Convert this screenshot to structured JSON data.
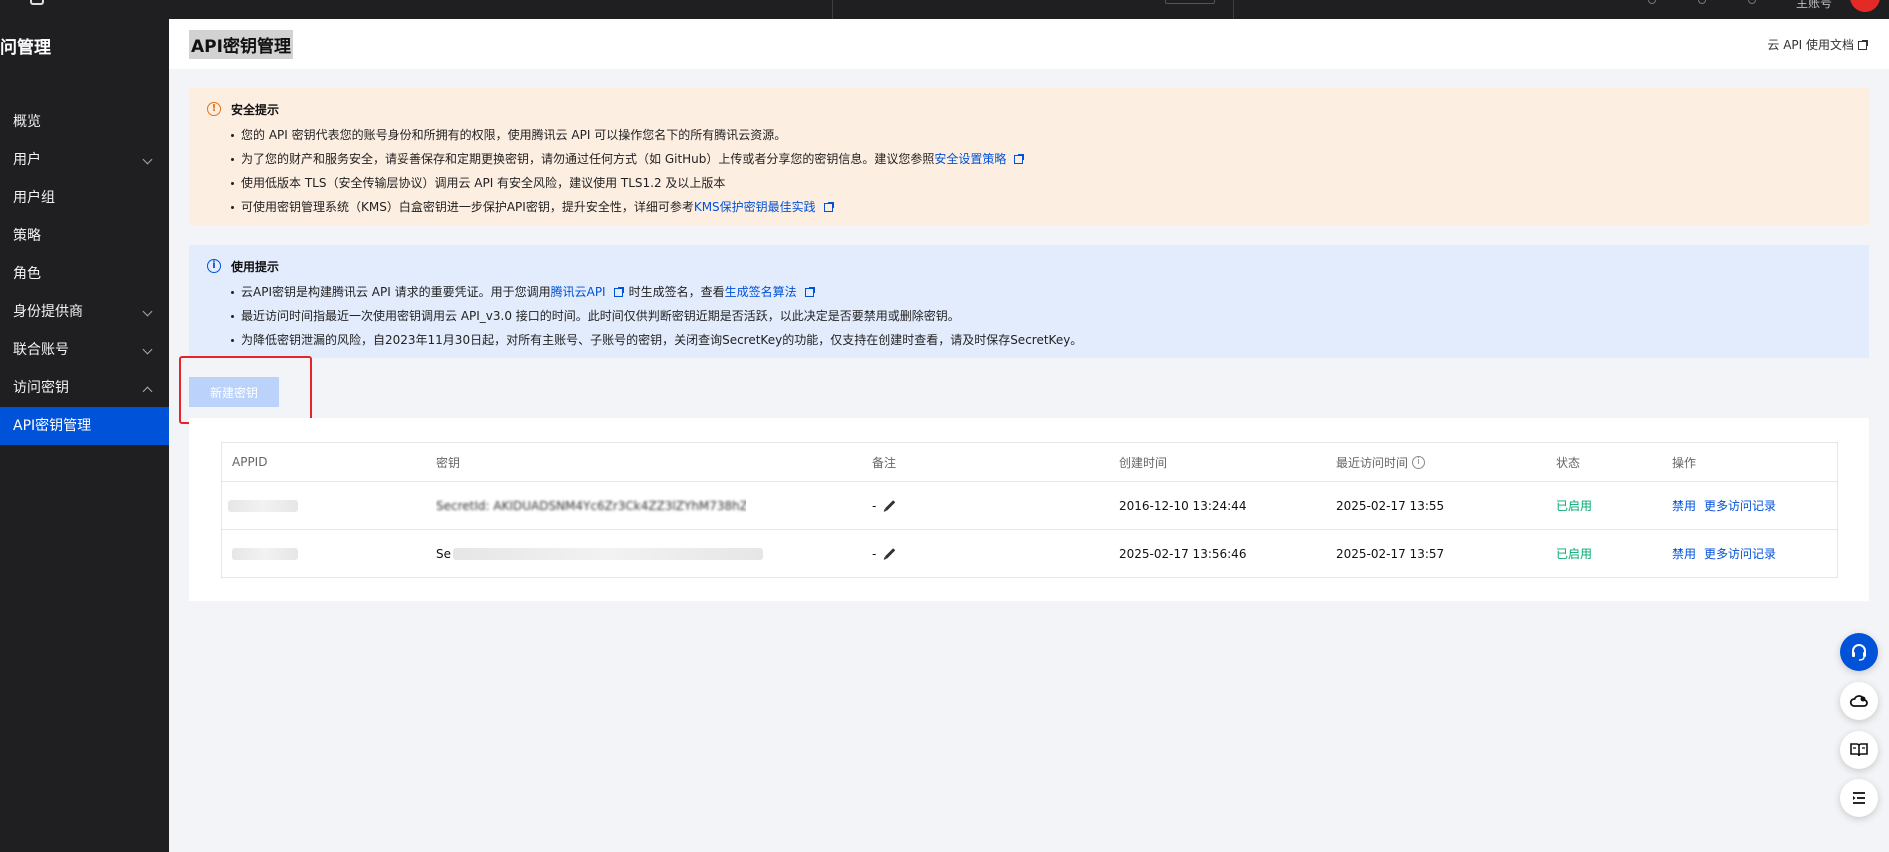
{
  "topbar": {
    "account": "主账号"
  },
  "sidebar": {
    "title": "问管理",
    "items": [
      {
        "label": "概览",
        "chevron": null
      },
      {
        "label": "用户",
        "chevron": "down"
      },
      {
        "label": "用户组",
        "chevron": null
      },
      {
        "label": "策略",
        "chevron": null
      },
      {
        "label": "角色",
        "chevron": null
      },
      {
        "label": "身份提供商",
        "chevron": "down"
      },
      {
        "label": "联合账号",
        "chevron": "down"
      },
      {
        "label": "访问密钥",
        "chevron": "up"
      },
      {
        "label": "API密钥管理",
        "chevron": null,
        "active": true
      }
    ]
  },
  "header": {
    "title": "API密钥管理",
    "doc_link": "云 API 使用文档"
  },
  "security_notice": {
    "title": "安全提示",
    "item1": "您的 API 密钥代表您的账号身份和所拥有的权限，使用腾讯云 API 可以操作您名下的所有腾讯云资源。",
    "item2_prefix": "为了您的财产和服务安全，请妥善保存和定期更换密钥，请勿通过任何方式（如 GitHub）上传或者分享您的密钥信息。建议您参照",
    "item2_link": "安全设置策略",
    "item3": "使用低版本 TLS（安全传输层协议）调用云 API 有安全风险，建议使用 TLS1.2 及以上版本",
    "item4_prefix": "可使用密钥管理系统（KMS）白盒密钥进一步保护API密钥，提升安全性，详细可参考",
    "item4_link": "KMS保护密钥最佳实践"
  },
  "usage_notice": {
    "title": "使用提示",
    "item1_prefix": "云API密钥是构建腾讯云 API 请求的重要凭证。用于您调用",
    "item1_link1": "腾讯云API",
    "item1_mid": "时生成签名，查看",
    "item1_link2": "生成签名算法",
    "item2": "最近访问时间指最近一次使用密钥调用云 API_v3.0 接口的时间。此时间仅供判断密钥近期是否活跃，以此决定是否要禁用或删除密钥。",
    "item3": "为降低密钥泄漏的风险，自2023年11月30日起，对所有主账号、子账号的密钥，关闭查询SecretKey的功能，仅支持在创建时查看，请及时保存SecretKey。"
  },
  "create_button": "新建密钥",
  "table": {
    "columns": [
      "APPID",
      "密钥",
      "备注",
      "创建时间",
      "最近访问时间",
      "状态",
      "操作"
    ],
    "rows": [
      {
        "appid": "",
        "secret": "SecretId: AKIDUADSNM4Yc6Zr3Ck4ZZ3lZYhM738hZhMW",
        "note": "-",
        "created": "2016-12-10 13:24:44",
        "last_access": "2025-02-17 13:55",
        "status": "已启用",
        "op_disable": "禁用",
        "op_more": "更多访问记录"
      },
      {
        "appid": "",
        "secret": "Se",
        "note": "-",
        "created": "2025-02-17 13:56:46",
        "last_access": "2025-02-17 13:57",
        "status": "已启用",
        "op_disable": "禁用",
        "op_more": "更多访问记录"
      }
    ]
  },
  "colors": {
    "primary": "#0052d9",
    "sidebar_bg": "#1f1f22",
    "security_bg": "#fdeee2",
    "usage_bg": "#e3ecfd",
    "status_ok": "#00a870",
    "highlight": "#e4232b"
  },
  "fabs": [
    "headset-icon",
    "cloud-icon",
    "book-icon",
    "list-icon"
  ]
}
